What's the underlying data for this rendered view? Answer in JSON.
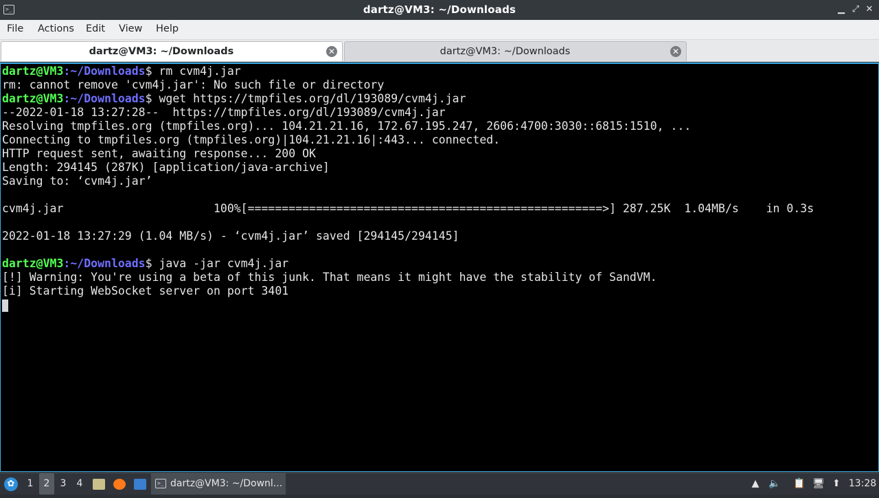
{
  "window": {
    "title": "dartz@VM3: ~/Downloads",
    "app_icon": "terminal-icon",
    "controls": {
      "minimize": "▁",
      "maximize": "⤢",
      "close": "✕"
    }
  },
  "menu": {
    "items": [
      "File",
      "Actions",
      "Edit",
      "View",
      "Help"
    ]
  },
  "tabs": [
    {
      "label": "dartz@VM3: ~/Downloads",
      "active": true,
      "close_icon": "close-circle-icon"
    },
    {
      "label": "dartz@VM3: ~/Downloads",
      "active": false,
      "close_icon": "close-circle-icon"
    }
  ],
  "terminal": {
    "colors": {
      "background": "#000000",
      "text": "#e6e6e6",
      "user": "#54ff54",
      "path": "#6f6fff",
      "border": "#3daee9"
    },
    "prompt": {
      "user": "dartz@VM3",
      "sep": ":",
      "path": "~/Downloads",
      "sym": "$"
    },
    "lines": [
      {
        "type": "prompt",
        "cmd": " rm cvm4j.jar"
      },
      {
        "type": "out",
        "text": "rm: cannot remove 'cvm4j.jar': No such file or directory"
      },
      {
        "type": "prompt",
        "cmd": " wget https://tmpfiles.org/dl/193089/cvm4j.jar"
      },
      {
        "type": "out",
        "text": "--2022-01-18 13:27:28--  https://tmpfiles.org/dl/193089/cvm4j.jar"
      },
      {
        "type": "out",
        "text": "Resolving tmpfiles.org (tmpfiles.org)... 104.21.21.16, 172.67.195.247, 2606:4700:3030::6815:1510, ..."
      },
      {
        "type": "out",
        "text": "Connecting to tmpfiles.org (tmpfiles.org)|104.21.21.16|:443... connected."
      },
      {
        "type": "out",
        "text": "HTTP request sent, awaiting response... 200 OK"
      },
      {
        "type": "out",
        "text": "Length: 294145 (287K) [application/java-archive]"
      },
      {
        "type": "out",
        "text": "Saving to: ‘cvm4j.jar’"
      },
      {
        "type": "out",
        "text": ""
      },
      {
        "type": "out",
        "text": "cvm4j.jar                      100%[====================================================>] 287.25K  1.04MB/s    in 0.3s"
      },
      {
        "type": "out",
        "text": ""
      },
      {
        "type": "out",
        "text": "2022-01-18 13:27:29 (1.04 MB/s) - ‘cvm4j.jar’ saved [294145/294145]"
      },
      {
        "type": "out",
        "text": ""
      },
      {
        "type": "prompt",
        "cmd": " java -jar cvm4j.jar"
      },
      {
        "type": "out",
        "text": "[!] Warning: You're using a beta of this junk. That means it might have the stability of SandVM."
      },
      {
        "type": "out",
        "text": "[i] Starting WebSocket server on port 3401"
      },
      {
        "type": "cursor",
        "text": ""
      }
    ]
  },
  "taskbar": {
    "start_icon": "lxqt-start-icon",
    "workspaces": [
      {
        "label": "1",
        "active": false
      },
      {
        "label": "2",
        "active": true
      },
      {
        "label": "3",
        "active": false
      },
      {
        "label": "4",
        "active": false
      }
    ],
    "quicklaunch": [
      {
        "name": "file-manager-icon",
        "color": "#c9c08a"
      },
      {
        "name": "firefox-icon",
        "color": "#ff7a1a"
      },
      {
        "name": "show-desktop-icon",
        "color": "#3a7fd0"
      }
    ],
    "task": {
      "label": "dartz@VM3: ~/Downl...",
      "icon": "terminal-icon"
    },
    "tray": [
      {
        "name": "tray-arrow-icon",
        "glyph": "▲"
      },
      {
        "name": "volume-icon",
        "glyph": "🔈"
      },
      {
        "name": "clipboard-icon",
        "glyph": "📋"
      },
      {
        "name": "network-icon",
        "glyph": "🖥"
      },
      {
        "name": "updates-icon",
        "glyph": "⬆"
      }
    ],
    "clock": "13:28"
  }
}
